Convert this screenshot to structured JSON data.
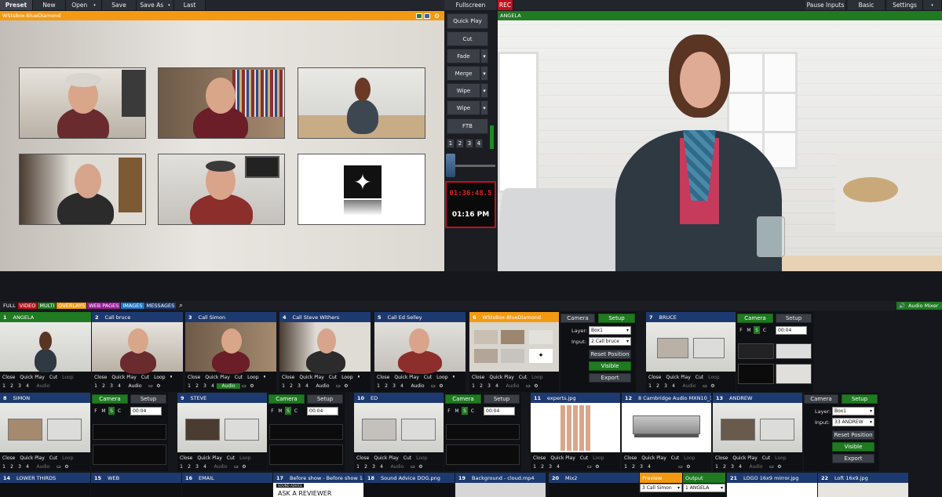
{
  "toolbar": {
    "preset": "Preset",
    "new": "New",
    "open": "Open",
    "save": "Save",
    "save_as": "Save As",
    "last": "Last",
    "fullscreen": "Fullscreen",
    "rec": "REC",
    "pause_inputs": "Pause Inputs",
    "basic": "Basic",
    "settings": "Settings"
  },
  "preview": {
    "title": "WStsBox-BlueDiamond"
  },
  "output": {
    "title": "ANGELA"
  },
  "transitions": {
    "quick_play": "Quick Play",
    "cut": "Cut",
    "fade": "Fade",
    "merge": "Merge",
    "wipe1": "Wipe",
    "wipe2": "Wipe",
    "ftb": "FTB",
    "nums": [
      "1",
      "2",
      "3",
      "4"
    ],
    "clock_time": "01:36:48.5",
    "clock_day": "01:16 PM"
  },
  "filters": {
    "full": "FULL",
    "video": "VIDEO",
    "multi": "MULTI",
    "overlays": "OVERLAYS",
    "web": "WEB PAGES",
    "images": "IMAGES",
    "messages": "MESSAGES",
    "audio_mixer": "Audio Mixer"
  },
  "ctrl": {
    "close": "Close",
    "quick_play": "Quick Play",
    "cut": "Cut",
    "loop": "Loop",
    "audio": "Audio",
    "nums": [
      "1",
      "2",
      "3",
      "4"
    ],
    "camera": "Camera",
    "setup": "Setup",
    "layer": "Layer:",
    "input": "Input:",
    "reset_position": "Reset Position",
    "visible": "Visible",
    "export": "Export",
    "f": "F",
    "m": "M",
    "s": "S",
    "c": "C",
    "time": "00:04"
  },
  "inputs": [
    {
      "num": "1",
      "title": "ANGELA"
    },
    {
      "num": "2",
      "title": "Call bruce"
    },
    {
      "num": "3",
      "title": "Call Simon"
    },
    {
      "num": "4",
      "title": "Call Steve Withers"
    },
    {
      "num": "5",
      "title": "Call Ed Selley"
    },
    {
      "num": "6",
      "title": "WStsBox-BlueDiamond"
    },
    {
      "num": "7",
      "title": "BRUCE"
    },
    {
      "num": "8",
      "title": "SIMON"
    },
    {
      "num": "9",
      "title": "STEVE"
    },
    {
      "num": "10",
      "title": "ED"
    },
    {
      "num": "11",
      "title": "experts.jpg"
    },
    {
      "num": "12",
      "title": "8 Cambridge Audio MXN10_1.jpg"
    },
    {
      "num": "13",
      "title": "ANDREW"
    },
    {
      "num": "14",
      "title": "LOWER THIRDS"
    },
    {
      "num": "15",
      "title": "WEB"
    },
    {
      "num": "16",
      "title": "EMAIL"
    },
    {
      "num": "17",
      "title": "Before show - Before show 1.jpg"
    },
    {
      "num": "18",
      "title": "Sound Advice DOG.png"
    },
    {
      "num": "19",
      "title": "Background - cloud.mp4"
    },
    {
      "num": "20",
      "title": "Mix2"
    },
    {
      "num": "21",
      "title": "LOGO 16x9 mirror.jpg"
    },
    {
      "num": "22",
      "title": "Loft 16x9.jpg"
    }
  ],
  "input6_setup": {
    "layer": "Box1",
    "input": "2 Call bruce"
  },
  "input13_setup": {
    "layer": "Box1",
    "input": "33 ANDREW"
  },
  "mix2": {
    "preview_label": "Preview",
    "output_label": "Output",
    "preview_value": "3 Call Simon",
    "output_value": "1 ANGELA"
  },
  "card17": {
    "logo": "SOUND ADVICE",
    "text": "ASK A REVIEWER"
  },
  "colors": {
    "accent_orange": "#f39a12",
    "green": "#1f7a21",
    "blue_bar": "#1d3a70",
    "rec_red": "#c0121b"
  }
}
